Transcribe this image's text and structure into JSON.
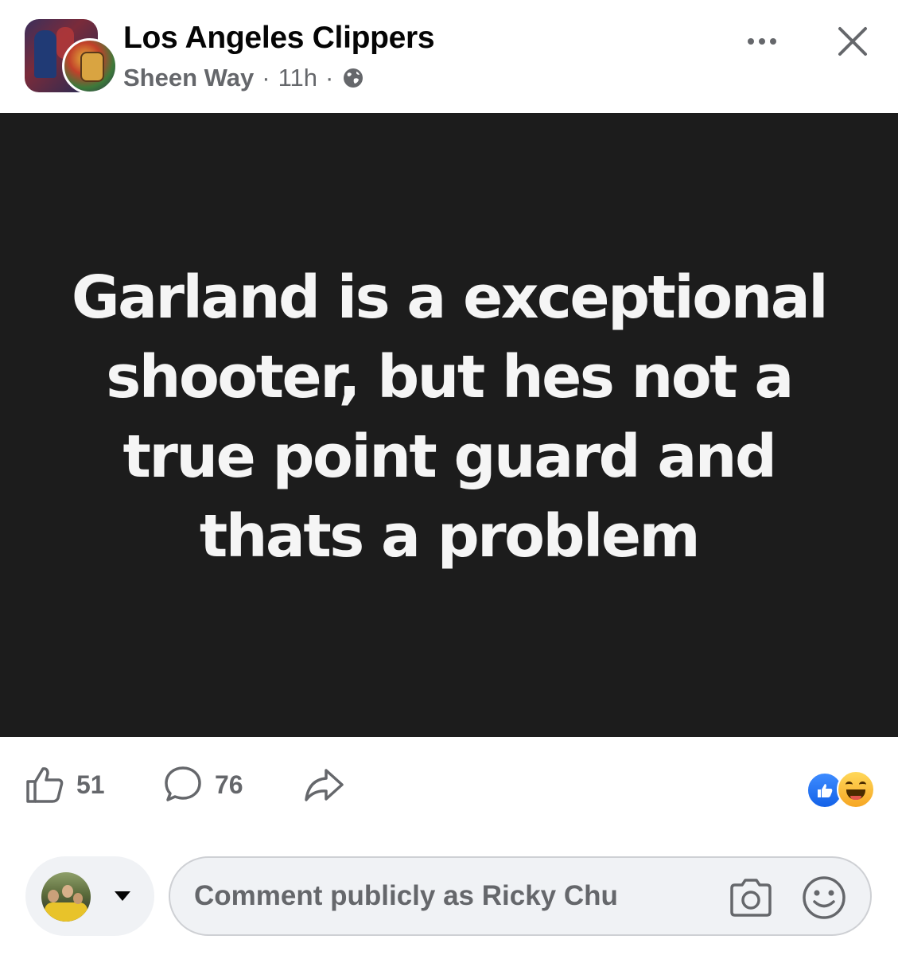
{
  "header": {
    "group_name": "Los Angeles Clippers",
    "author": "Sheen Way",
    "separator": "·",
    "time": "11h",
    "privacy_icon": "globe-icon",
    "more_icon": "more-horizontal-icon",
    "close_icon": "close-icon"
  },
  "post": {
    "background": "#1c1c1c",
    "text": "Garland is a exceptional shooter, but hes not a true point guard and thats a problem"
  },
  "actions": {
    "likes": "51",
    "comments": "76",
    "like_icon": "thumbs-up-icon",
    "comment_icon": "comment-bubble-icon",
    "share_icon": "share-arrow-icon"
  },
  "reactions": [
    "like",
    "haha"
  ],
  "composer": {
    "placeholder": "Comment publicly as Ricky Chu",
    "camera_icon": "camera-icon",
    "emoji_icon": "smiley-icon"
  }
}
